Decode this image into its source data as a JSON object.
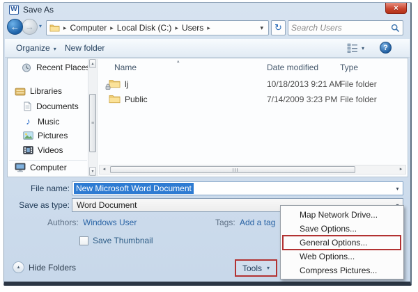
{
  "window": {
    "title": "Save As"
  },
  "icons": {
    "word_logo": "W",
    "close": "×",
    "back_arrow": "←",
    "forward_arrow": "→",
    "nav_history_dropdown": "▾",
    "crumb_arrow": "▸",
    "refresh": "↻",
    "search_magnifier": "circle-with-handle",
    "organize_dropdown": "▾",
    "views_dropdown": "▾",
    "help": "?",
    "sort_ascending": "▴",
    "scroll_up": "▴",
    "scroll_down": "▾",
    "scroll_left": "◂",
    "scroll_right": "▸",
    "scroll_grip": "≡",
    "music_note": "♪",
    "hide_folders_arrow": "▴",
    "combo_dropdown": "▾"
  },
  "address_bar": {
    "crumbs": [
      "Computer",
      "Local Disk (C:)",
      "Users"
    ],
    "search_placeholder": "Search Users"
  },
  "toolbar": {
    "organize_label": "Organize",
    "new_folder_label": "New folder"
  },
  "sidebar": {
    "items": [
      {
        "label": "Recent Places"
      },
      {
        "label": "Libraries"
      },
      {
        "label": "Documents"
      },
      {
        "label": "Music"
      },
      {
        "label": "Pictures"
      },
      {
        "label": "Videos"
      },
      {
        "label": "Computer"
      }
    ]
  },
  "file_list": {
    "columns": [
      "Name",
      "Date modified",
      "Type"
    ],
    "rows": [
      {
        "name": "lj",
        "date_modified": "10/18/2013 9:21 AM",
        "type": "File folder"
      },
      {
        "name": "Public",
        "date_modified": "7/14/2009 3:23 PM",
        "type": "File folder"
      }
    ]
  },
  "fields": {
    "file_name_label": "File name:",
    "file_name_value": "New Microsoft Word Document",
    "save_as_type_label": "Save as type:",
    "save_as_type_value": "Word Document",
    "authors_label": "Authors:",
    "authors_value": "Windows User",
    "tags_label": "Tags:",
    "tags_value": "Add a tag",
    "save_thumbnail_label": "Save Thumbnail",
    "save_thumbnail_checked": false
  },
  "footer": {
    "hide_folders_label": "Hide Folders",
    "tools_label": "Tools"
  },
  "tools_menu": {
    "items": [
      "Map Network Drive...",
      "Save Options...",
      "General Options...",
      "Web Options...",
      "Compress Pictures..."
    ],
    "highlighted_item": "General Options..."
  },
  "annotations": {
    "highlight_color": "#b23232",
    "boxed_elements": [
      "Tools button",
      "General Options... menu item"
    ]
  }
}
